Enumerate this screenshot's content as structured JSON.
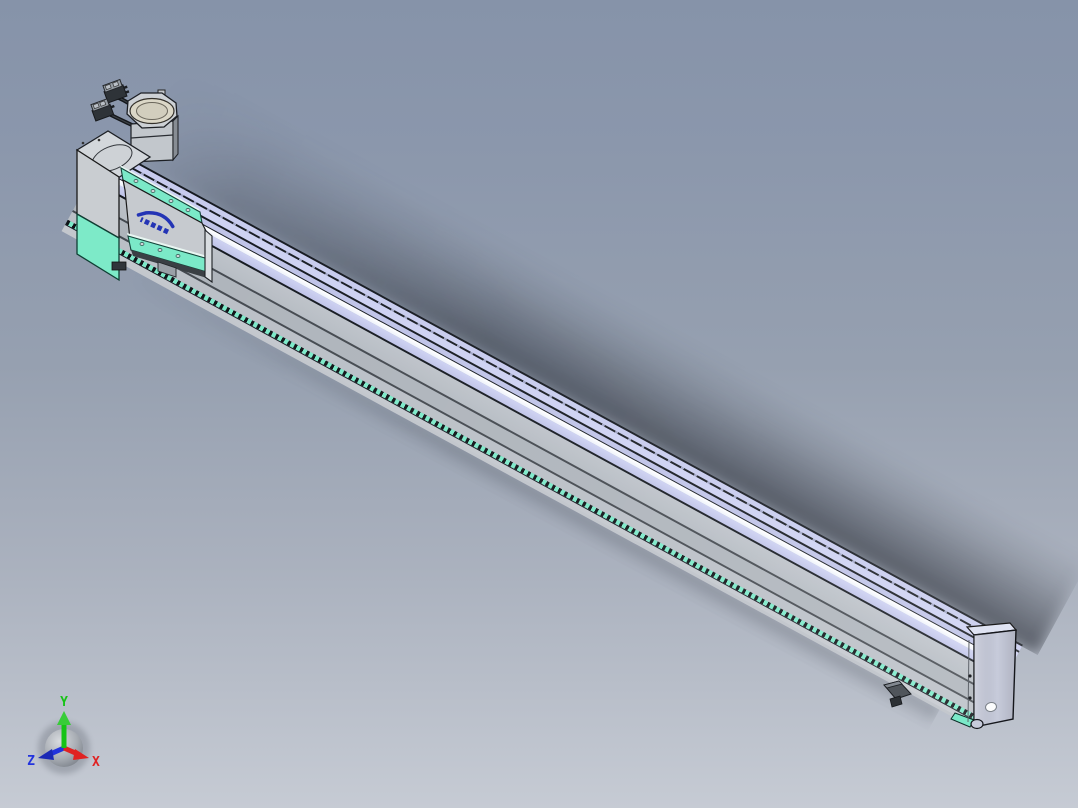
{
  "viewport": {
    "label": "3d-cad-viewport",
    "background_top": "#8693a9",
    "background_bottom": "#c6cbd4"
  },
  "model": {
    "label": "linear-actuator-rail-module",
    "parts": {
      "motor": "stepper-motor-with-cable-connectors",
      "carriage": "slider-carriage-with-brand-logo",
      "rail": "aluminum-extrusion-rail",
      "end_block": "motor-end-block",
      "end_cap": "far-end-cap",
      "sensor": "limit-sensor-block"
    },
    "icons": {
      "carriage_logo": "brand-swoosh-logo"
    },
    "colors": {
      "rail_top": "#c7cbee",
      "rail_highlight": "#eef2fb",
      "rail_side": "#b6bcc3",
      "accent_teal": "#7be9c8",
      "mint_block": "#7deac8",
      "motor_flange": "#dbd7c7",
      "end_cap_face": "#c7cbdb",
      "logo_blue": "#2334b5"
    }
  },
  "triad": {
    "axes": [
      {
        "label": "X",
        "color": "#e02222"
      },
      {
        "label": "Y",
        "color": "#16c316"
      },
      {
        "label": "Z",
        "color": "#2233dd"
      }
    ]
  }
}
